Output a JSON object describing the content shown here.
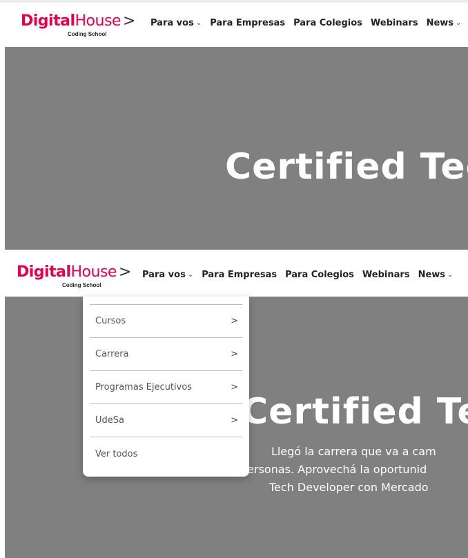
{
  "logo": {
    "part1": "Digital",
    "part2": "House",
    "chevron": ">",
    "tagline": "Coding School"
  },
  "nav": [
    {
      "label": "Para vos",
      "caret": "⌄"
    },
    {
      "label": "Para Empresas"
    },
    {
      "label": "Para Colegios"
    },
    {
      "label": "Webinars"
    },
    {
      "label": "News",
      "caret": "⌄"
    }
  ],
  "hero": {
    "title": "Certified Tec",
    "title_bottom": "Certified Tec",
    "lines": [
      "Llegó la carrera que va a cam",
      "personas. Aprovechá la oportunid",
      "Tech Developer con Mercado"
    ]
  },
  "dropdown": {
    "items": [
      {
        "label": "Cursos",
        "chevron": ">"
      },
      {
        "label": "Carrera",
        "chevron": ">"
      },
      {
        "label": "Programas Ejecutivos",
        "chevron": ">"
      },
      {
        "label": "UdeSa",
        "chevron": ">"
      },
      {
        "label": "Ver todos"
      }
    ]
  },
  "colors": {
    "brand": "#e5004b",
    "hero_bg": "#808080"
  }
}
